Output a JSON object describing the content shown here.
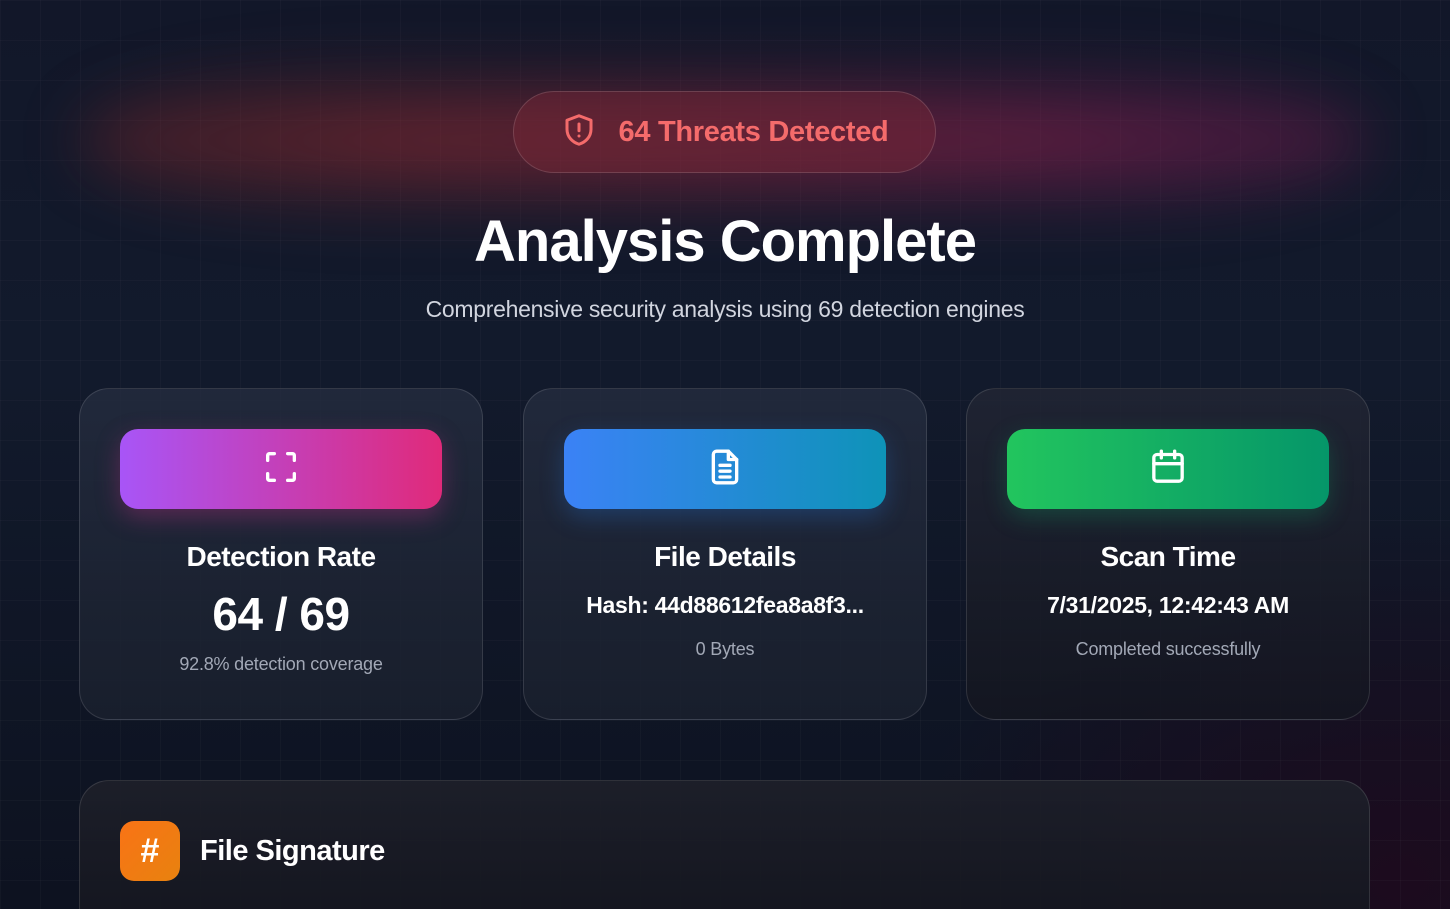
{
  "status_badge": {
    "text": "64 Threats Detected",
    "icon": "shield-alert-icon",
    "color": "#f46b6b"
  },
  "header": {
    "title": "Analysis Complete",
    "subtitle": "Comprehensive security analysis using 69 detection engines"
  },
  "cards": [
    {
      "icon": "scan-icon",
      "label": "Detection Rate",
      "value": "64 / 69",
      "note": "92.8% detection coverage",
      "gradient": [
        "#a855f7",
        "#e02a7a"
      ]
    },
    {
      "icon": "file-text-icon",
      "label": "File Details",
      "value": "Hash: 44d88612fea8a8f3...",
      "note": "0 Bytes",
      "gradient": [
        "#3b82f6",
        "#0e93b8"
      ]
    },
    {
      "icon": "calendar-icon",
      "label": "Scan Time",
      "value": "7/31/2025, 12:42:43 AM",
      "note": "Completed successfully",
      "gradient": [
        "#22c55e",
        "#059669"
      ]
    }
  ],
  "signature_panel": {
    "icon": "hash-icon",
    "icon_glyph": "#",
    "title": "File Signature"
  }
}
